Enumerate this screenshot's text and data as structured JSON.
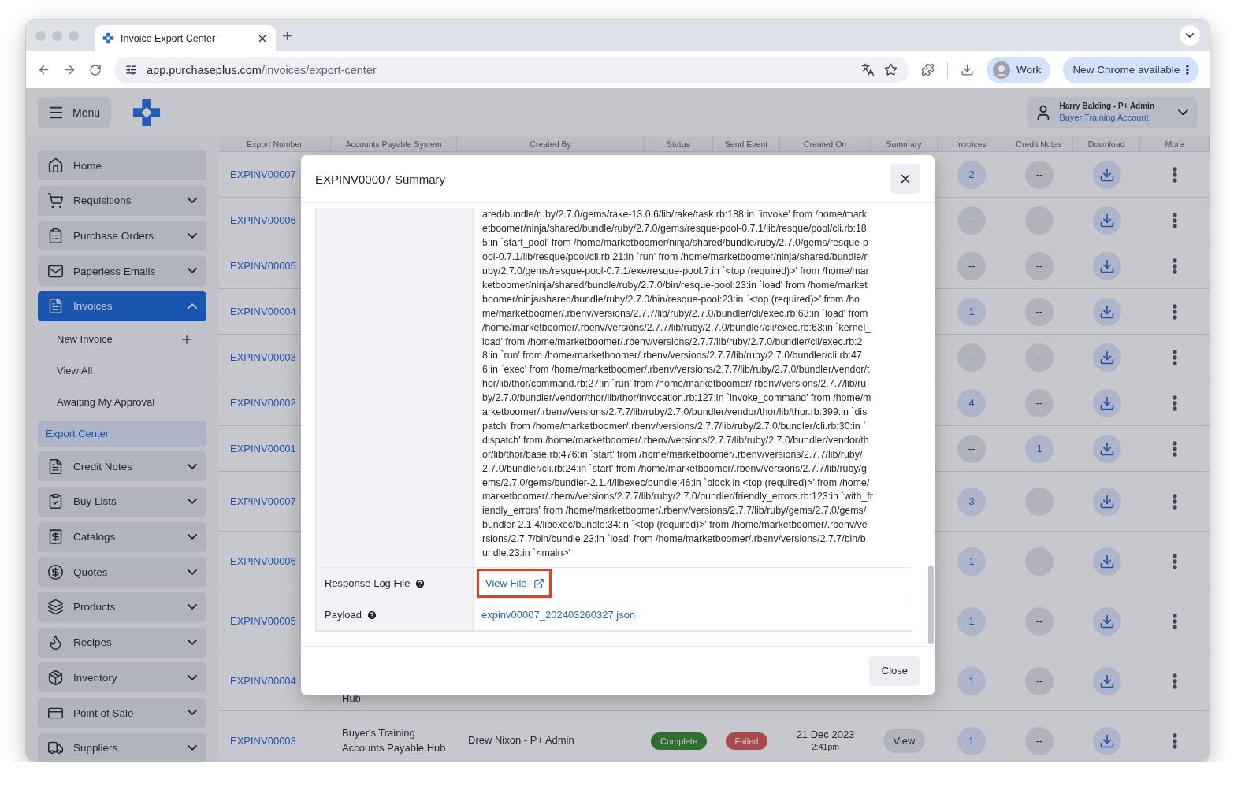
{
  "browser": {
    "tabs": [
      {
        "title": "Invoice Export Center",
        "selected": true
      }
    ],
    "url_host": "app.purchaseplus.com",
    "url_path": "/invoices/export-center",
    "profile": "Work",
    "update_notice": "New Chrome available"
  },
  "app_header": {
    "menu_label": "Menu",
    "user_name": "Harry Balding - P+ Admin",
    "account": "Buyer Training Account"
  },
  "sidebar": {
    "items": [
      {
        "label": "Home",
        "expandable": false,
        "selected": false
      },
      {
        "label": "Requisitions",
        "expandable": true,
        "expanded": false,
        "selected": false
      },
      {
        "label": "Purchase Orders",
        "expandable": true,
        "expanded": false,
        "selected": false
      },
      {
        "label": "Paperless Emails",
        "expandable": true,
        "expanded": false,
        "selected": false
      },
      {
        "label": "Invoices",
        "expandable": true,
        "expanded": true,
        "selected": true,
        "children": [
          {
            "label": "New Invoice",
            "addable": true,
            "selected": false
          },
          {
            "label": "View All",
            "addable": false,
            "selected": false
          },
          {
            "label": "Awaiting My Approval",
            "addable": false,
            "selected": false
          },
          {
            "label": "Export Center",
            "addable": false,
            "selected": true
          }
        ]
      },
      {
        "label": "Credit Notes",
        "expandable": true,
        "expanded": false,
        "selected": false
      },
      {
        "label": "Buy Lists",
        "expandable": true,
        "expanded": false,
        "selected": false
      },
      {
        "label": "Catalogs",
        "expandable": true,
        "expanded": false,
        "selected": false
      },
      {
        "label": "Quotes",
        "expandable": true,
        "expanded": false,
        "selected": false
      },
      {
        "label": "Products",
        "expandable": true,
        "expanded": false,
        "selected": false
      },
      {
        "label": "Recipes",
        "expandable": true,
        "expanded": false,
        "selected": false
      },
      {
        "label": "Inventory",
        "expandable": true,
        "expanded": false,
        "selected": false
      },
      {
        "label": "Point of Sale",
        "expandable": true,
        "expanded": false,
        "selected": false
      },
      {
        "label": "Suppliers",
        "expandable": true,
        "expanded": false,
        "selected": false
      }
    ]
  },
  "table": {
    "columns": [
      "Export Number",
      "Accounts Payable System",
      "Created By",
      "Status",
      "Send Event",
      "Created On",
      "Summary",
      "Invoices",
      "Credit Notes",
      "Download",
      "More"
    ],
    "rows": [
      {
        "export_number": "EXPINV00007",
        "invoices": {
          "text": "2",
          "active": true
        },
        "credit_notes": {
          "text": "--",
          "active": false
        }
      },
      {
        "export_number": "EXPINV00006",
        "invoices": {
          "text": "--",
          "active": false
        },
        "credit_notes": {
          "text": "--",
          "active": false
        }
      },
      {
        "export_number": "EXPINV00005",
        "invoices": {
          "text": "--",
          "active": false
        },
        "credit_notes": {
          "text": "--",
          "active": false
        }
      },
      {
        "export_number": "EXPINV00004",
        "invoices": {
          "text": "1",
          "active": true
        },
        "credit_notes": {
          "text": "--",
          "active": false
        }
      },
      {
        "export_number": "EXPINV00003",
        "invoices": {
          "text": "--",
          "active": false
        },
        "credit_notes": {
          "text": "--",
          "active": false
        }
      },
      {
        "export_number": "EXPINV00002",
        "invoices": {
          "text": "4",
          "active": true
        },
        "credit_notes": {
          "text": "--",
          "active": false
        }
      },
      {
        "export_number": "EXPINV00001",
        "invoices": {
          "text": "--",
          "active": false
        },
        "credit_notes": {
          "text": "1",
          "active": true
        }
      },
      {
        "export_number": "EXPINV00007",
        "invoices": {
          "text": "3",
          "active": true
        },
        "credit_notes": {
          "text": "--",
          "active": false
        }
      },
      {
        "export_number": "EXPINV00006",
        "invoices": {
          "text": "1",
          "active": true
        },
        "credit_notes": {
          "text": "--",
          "active": false
        }
      },
      {
        "export_number": "EXPINV00005",
        "invoices": {
          "text": "1",
          "active": true
        },
        "credit_notes": {
          "text": "--",
          "active": false
        }
      },
      {
        "export_number": "EXPINV00004",
        "ap_system": "Hub",
        "invoices": {
          "text": "1",
          "active": true
        },
        "credit_notes": {
          "text": "--",
          "active": false
        }
      },
      {
        "export_number": "EXPINV00003",
        "ap_system": "Buyer's Training Accounts Payable Hub",
        "created_by": "Drew Nixon - P+ Admin",
        "status": {
          "text": "Complete",
          "kind": "success"
        },
        "send_event": {
          "text": "Failed",
          "kind": "error"
        },
        "created_on": {
          "date": "21 Dec 2023",
          "time": "2:41pm"
        },
        "summary": "View",
        "invoices": {
          "text": "1",
          "active": true
        },
        "credit_notes": {
          "text": "--",
          "active": false
        }
      }
    ]
  },
  "modal": {
    "title": "EXPINV00007 Summary",
    "trace_lines": [
      "ared/bundle/ruby/2.7.0/gems/rake-13.0.6/lib/rake/task.rb:188:in `invoke' from /home/mark",
      "etboomer/ninja/shared/bundle/ruby/2.7.0/gems/resque-pool-0.7.1/lib/resque/pool/cli.rb:18",
      "5:in `start_pool' from /home/marketboomer/ninja/shared/bundle/ruby/2.7.0/gems/resque-p",
      "ool-0.7.1/lib/resque/pool/cli.rb:21:in `run' from /home/marketboomer/ninja/shared/bundle/r",
      "uby/2.7.0/gems/resque-pool-0.7.1/exe/resque-pool:7:in `<top (required)>' from /home/mar",
      "ketboomer/ninja/shared/bundle/ruby/2.7.0/bin/resque-pool:23:in `load' from /home/market",
      "boomer/ninja/shared/bundle/ruby/2.7.0/bin/resque-pool:23:in `<top (required)>' from /ho",
      "me/marketboomer/.rbenv/versions/2.7.7/lib/ruby/2.7.0/bundler/cli/exec.rb:63:in `load' from",
      "/home/marketboomer/.rbenv/versions/2.7.7/lib/ruby/2.7.0/bundler/cli/exec.rb:63:in `kernel_",
      "load' from /home/marketboomer/.rbenv/versions/2.7.7/lib/ruby/2.7.0/bundler/cli/exec.rb:2",
      "8:in `run' from /home/marketboomer/.rbenv/versions/2.7.7/lib/ruby/2.7.0/bundler/cli.rb:47",
      "6:in `exec' from /home/marketboomer/.rbenv/versions/2.7.7/lib/ruby/2.7.0/bundler/vendor/t",
      "hor/lib/thor/command.rb:27:in `run' from /home/marketboomer/.rbenv/versions/2.7.7/lib/ru",
      "by/2.7.0/bundler/vendor/thor/lib/thor/invocation.rb:127:in `invoke_command' from /home/m",
      "arketboomer/.rbenv/versions/2.7.7/lib/ruby/2.7.0/bundler/vendor/thor/lib/thor.rb:399:in `dis",
      "patch' from /home/marketboomer/.rbenv/versions/2.7.7/lib/ruby/2.7.0/bundler/cli.rb:30:in `",
      "dispatch' from /home/marketboomer/.rbenv/versions/2.7.7/lib/ruby/2.7.0/bundler/vendor/th",
      "or/lib/thor/base.rb:476:in `start' from /home/marketboomer/.rbenv/versions/2.7.7/lib/ruby/",
      "2.7.0/bundler/cli.rb:24:in `start' from /home/marketboomer/.rbenv/versions/2.7.7/lib/ruby/g",
      "ems/2.7.0/gems/bundler-2.1.4/libexec/bundle:46:in `block in <top (required)>' from /home/",
      "marketboomer/.rbenv/versions/2.7.7/lib/ruby/2.7.0/bundler/friendly_errors.rb:123:in `with_fr",
      "iendly_errors' from /home/marketboomer/.rbenv/versions/2.7.7/lib/ruby/gems/2.7.0/gems/",
      "bundler-2.1.4/libexec/bundle:34:in `<top (required)>' from /home/marketboomer/.rbenv/ve",
      "rsions/2.7.7/bin/bundle:23:in `load' from /home/marketboomer/.rbenv/versions/2.7.7/bin/b",
      "undle:23:in `<main>'"
    ],
    "fields": [
      {
        "label": "Response Log File",
        "value": "View File",
        "kind": "external",
        "highlighted": true
      },
      {
        "label": "Payload",
        "value": "expinv00007_202403260327.json",
        "kind": "file",
        "highlighted": false
      }
    ],
    "close_label": "Close"
  }
}
